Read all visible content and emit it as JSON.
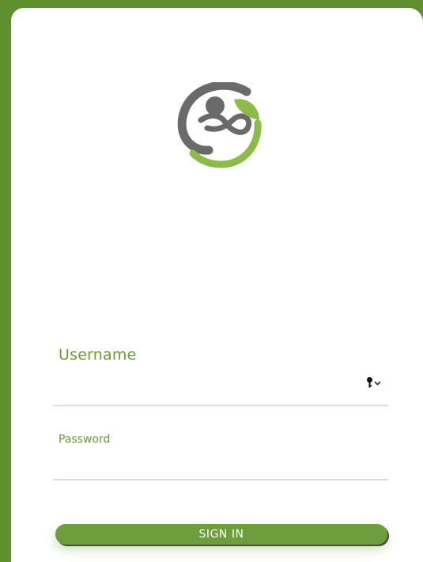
{
  "logo": {
    "icon": "infinity-leaf-person-logo",
    "colors": {
      "gray": "#6a6a6a",
      "green": "#8bbc4a"
    }
  },
  "form": {
    "username": {
      "label": "Username",
      "value": "",
      "key_icon": "key-icon",
      "dropdown_icon": "chevron-down-icon"
    },
    "password": {
      "label": "Password",
      "value": ""
    },
    "signin_label": "SIGN IN"
  },
  "colors": {
    "accent": "#6d9d3c",
    "label": "#6a9a3a",
    "frame": "#5f8f2f",
    "underline": "#dddddd"
  }
}
